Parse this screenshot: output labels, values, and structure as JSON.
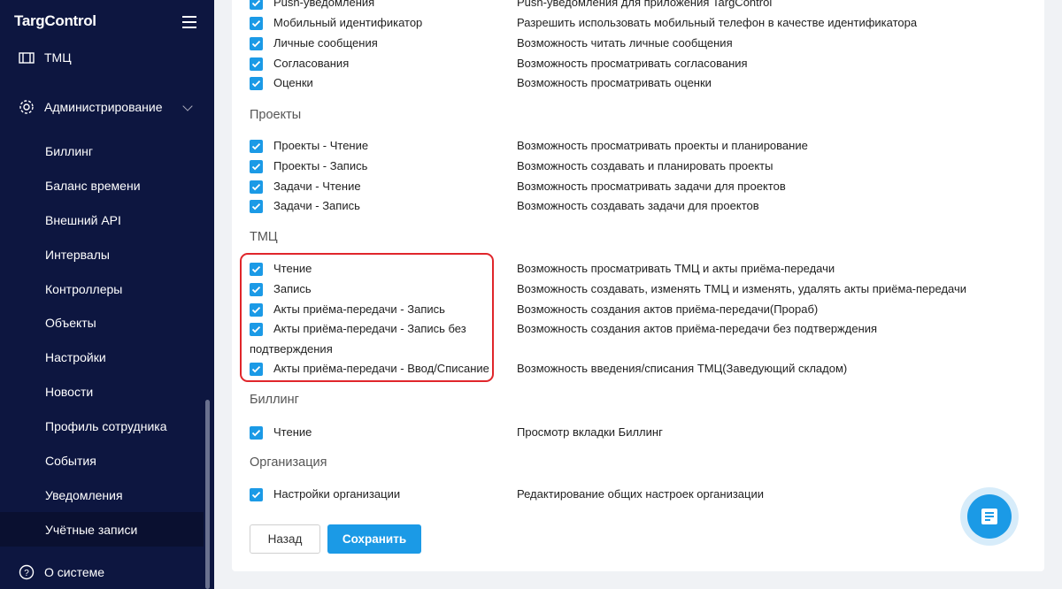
{
  "sidebar": {
    "logo": "TargControl",
    "items": [
      {
        "label": "ТМЦ"
      },
      {
        "label": "Администрирование"
      }
    ],
    "sub_items": [
      {
        "label": "Биллинг"
      },
      {
        "label": "Баланс времени"
      },
      {
        "label": "Внешний API"
      },
      {
        "label": "Интервалы"
      },
      {
        "label": "Контроллеры"
      },
      {
        "label": "Объекты"
      },
      {
        "label": "Настройки"
      },
      {
        "label": "Новости"
      },
      {
        "label": "Профиль сотрудника"
      },
      {
        "label": "События"
      },
      {
        "label": "Уведомления"
      },
      {
        "label": "Учётные записи"
      }
    ],
    "bottom": {
      "label": "О системе"
    }
  },
  "permissions": {
    "general": [
      {
        "name": "Push-уведомления",
        "desc": "Push-уведомления для приложения TargControl"
      },
      {
        "name": "Мобильный идентификатор",
        "desc": "Разрешить использовать мобильный телефон в качестве идентификатора"
      },
      {
        "name": "Личные сообщения",
        "desc": "Возможность читать личные сообщения"
      },
      {
        "name": "Согласования",
        "desc": "Возможность просматривать согласования"
      },
      {
        "name": "Оценки",
        "desc": "Возможность просматривать оценки"
      }
    ],
    "projects": {
      "title": "Проекты",
      "rows": [
        {
          "name": "Проекты - Чтение",
          "desc": "Возможность просматривать проекты и планирование"
        },
        {
          "name": "Проекты - Запись",
          "desc": "Возможность создавать и планировать проекты"
        },
        {
          "name": "Задачи - Чтение",
          "desc": "Возможность просматривать задачи для проектов"
        },
        {
          "name": "Задачи - Запись",
          "desc": "Возможность создавать задачи для проектов"
        }
      ]
    },
    "tmc": {
      "title": "ТМЦ",
      "rows": [
        {
          "name": "Чтение",
          "desc": "Возможность просматривать ТМЦ и акты приёма-передачи"
        },
        {
          "name": "Запись",
          "desc": "Возможность создавать, изменять ТМЦ и изменять, удалять акты приёма-передачи"
        },
        {
          "name": "Акты приёма-передачи - Запись",
          "desc": "Возможность создания актов приёма-передачи(Прораб)"
        },
        {
          "name": "Акты приёма-передачи - Запись без подтверждения",
          "desc": "Возможность создания актов приёма-передачи без подтверждения"
        },
        {
          "name": "Акты приёма-передачи - Ввод/Списание",
          "desc": "Возможность введения/списания ТМЦ(Заведующий складом)"
        }
      ]
    },
    "billing": {
      "title": "Биллинг",
      "rows": [
        {
          "name": "Чтение",
          "desc": "Просмотр вкладки Биллинг"
        }
      ]
    },
    "organization": {
      "title": "Организация",
      "rows": [
        {
          "name": "Настройки организации",
          "desc": "Редактирование общих настроек организации"
        }
      ]
    }
  },
  "buttons": {
    "back": "Назад",
    "save": "Сохранить"
  },
  "colors": {
    "accent": "#1b9ae6",
    "sidebar": "#0d1640",
    "highlight": "#e0262b"
  }
}
